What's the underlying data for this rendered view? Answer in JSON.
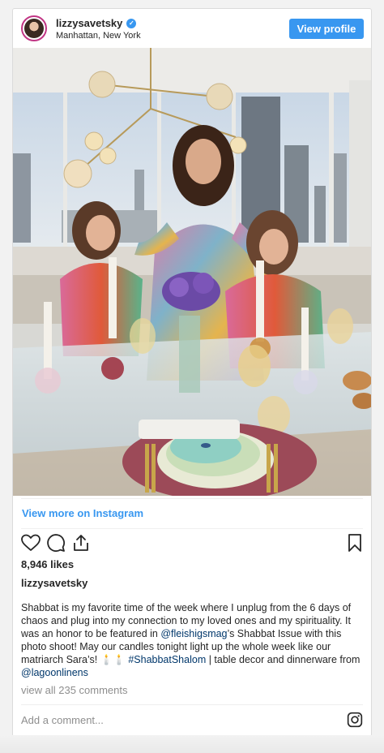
{
  "header": {
    "username": "lizzysavetsky",
    "location": "Manhattan, New York",
    "view_profile": "View profile"
  },
  "photo": {
    "description_icon": "image-post"
  },
  "view_more": "View more on Instagram",
  "actions": {
    "like_icon": "heart-icon",
    "comment_icon": "comment-icon",
    "share_icon": "share-icon",
    "save_icon": "bookmark-icon"
  },
  "likes": "8,946 likes",
  "caption": {
    "owner": "lizzysavetsky",
    "part1": "Shabbat is my favorite time of the week where I unplug from the 6 days of chaos and plug into my connection to my loved ones and my spirituality. It was an honor to be featured in ",
    "mention1": "@fleishigsmag",
    "part2": "’s Shabbat Issue with this photo shoot! May our candles tonight light up the whole week like our matriarch Sara’s! 🕯️🕯️ ",
    "hashtag": "#ShabbatShalom",
    "part3": " | table decor and dinnerware from ",
    "mention2": "@lagoonlinens"
  },
  "comments": "view all 235 comments",
  "add_comment_placeholder": "Add a comment...",
  "colors": {
    "accent": "#3897f0",
    "link": "#00376b",
    "muted": "#8e8e8e",
    "text": "#262626"
  }
}
